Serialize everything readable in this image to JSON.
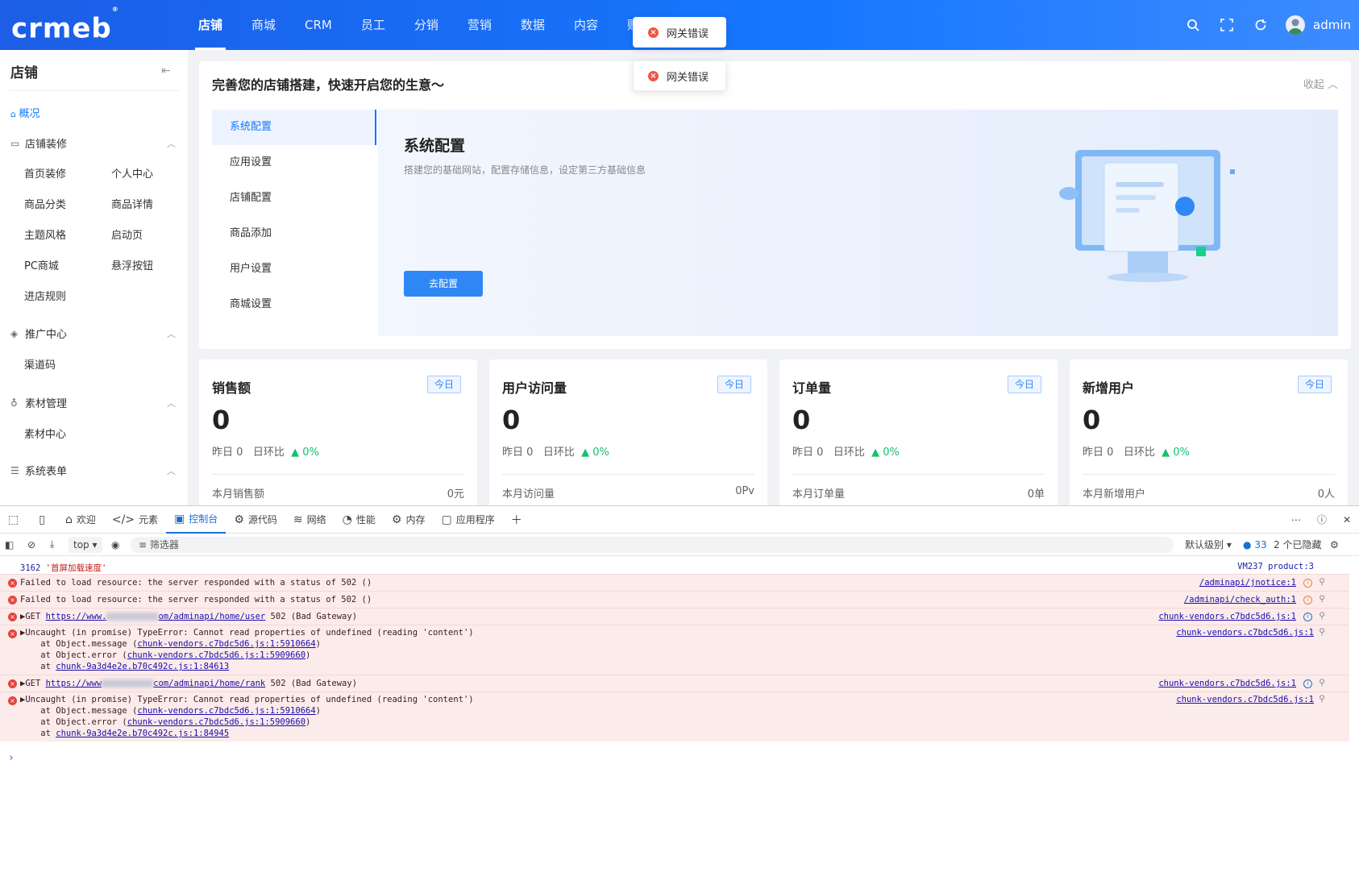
{
  "header": {
    "logo": "crmeb",
    "nav": [
      "店铺",
      "商城",
      "CRM",
      "员工",
      "分销",
      "营销",
      "数据",
      "内容",
      "财务"
    ],
    "username": "admin"
  },
  "sidebar": {
    "title": "店铺",
    "overview": "概况",
    "groups": [
      {
        "label": "店铺装修",
        "items": [
          "首页装修",
          "个人中心",
          "商品分类",
          "商品详情",
          "主题风格",
          "启动页",
          "PC商城",
          "悬浮按钮",
          "进店规则"
        ]
      },
      {
        "label": "推广中心",
        "items": [
          "渠道码"
        ]
      },
      {
        "label": "素材管理",
        "items": [
          "素材中心"
        ]
      },
      {
        "label": "系统表单",
        "items": []
      }
    ]
  },
  "guide": {
    "title": "完善您的店铺搭建，快速开启您的生意～",
    "collapse": "收起",
    "tabs": [
      "系统配置",
      "应用设置",
      "店铺配置",
      "商品添加",
      "用户设置",
      "商城设置"
    ],
    "panel_title": "系统配置",
    "panel_desc": "搭建您的基础网站，配置存储信息，设定第三方基础信息",
    "panel_button": "去配置"
  },
  "stats": [
    {
      "title": "销售额",
      "tag": "今日",
      "value": "0",
      "yesterday": "昨日 0",
      "ratio_label": "日环比",
      "ratio": "0%",
      "foot_label": "本月销售额",
      "foot_value": "0元"
    },
    {
      "title": "用户访问量",
      "tag": "今日",
      "value": "0",
      "yesterday": "昨日 0",
      "ratio_label": "日环比",
      "ratio": "0%",
      "foot_label": "本月访问量",
      "foot_value": "0Pv"
    },
    {
      "title": "订单量",
      "tag": "今日",
      "value": "0",
      "yesterday": "昨日 0",
      "ratio_label": "日环比",
      "ratio": "0%",
      "foot_label": "本月订单量",
      "foot_value": "0单"
    },
    {
      "title": "新增用户",
      "tag": "今日",
      "value": "0",
      "yesterday": "昨日 0",
      "ratio_label": "日环比",
      "ratio": "0%",
      "foot_label": "本月新增用户",
      "foot_value": "0人"
    }
  ],
  "toasts": [
    "网关错误",
    "网关错误"
  ],
  "devtools": {
    "tabs": [
      "欢迎",
      "元素",
      "控制台",
      "源代码",
      "网络",
      "性能",
      "内存",
      "应用程序"
    ],
    "context": "top",
    "filter_placeholder": "筛选器",
    "level": "默认级别",
    "msg_count": "33",
    "hidden": "2 个已隐藏",
    "logs": {
      "l1_num": "3162",
      "l1_text": "'首屏加载速度'",
      "l1_src": "VM237 product:3",
      "l2_text": "Failed to load resource: the server responded with a status of 502 ()",
      "l2_src": "/adminapi/jnotice:1",
      "l3_text": "Failed to load resource: the server responded with a status of 502 ()",
      "l3_src": "/adminapi/check_auth:1",
      "l4_pre": "▶GET ",
      "l4_url_a": "https://www.",
      "l4_url_b": "om/adminapi/home/user",
      "l4_post": " 502 (Bad Gateway)",
      "l4_src": "chunk-vendors.c7bdc5d6.js:1",
      "l5_text": "▶Uncaught (in promise) TypeError: Cannot read properties of undefined (reading 'content')",
      "l5_src": "chunk-vendors.c7bdc5d6.js:1",
      "l5_a_pre": "    at Object.message (",
      "l5_a_link": "chunk-vendors.c7bdc5d6.js:1:5910664",
      "l5_b_pre": "    at Object.error (",
      "l5_b_link": "chunk-vendors.c7bdc5d6.js:1:5909660",
      "l5_c_pre": "    at ",
      "l5_c_link": "chunk-9a3d4e2e.b70c492c.js:1:84613",
      "l6_pre": "▶GET ",
      "l6_url_a": "https://www",
      "l6_url_b": "com/adminapi/home/rank",
      "l6_post": " 502 (Bad Gateway)",
      "l6_src": "chunk-vendors.c7bdc5d6.js:1",
      "l7_text": "▶Uncaught (in promise) TypeError: Cannot read properties of undefined (reading 'content')",
      "l7_src": "chunk-vendors.c7bdc5d6.js:1",
      "l7_a_link": "chunk-vendors.c7bdc5d6.js:1:5910664",
      "l7_b_link": "chunk-vendors.c7bdc5d6.js:1:5909660",
      "l7_c_link": "chunk-9a3d4e2e.b70c492c.js:1:84945",
      "close_paren": ")"
    }
  },
  "colors": {
    "primary": "#1677ff",
    "success": "#13c26b",
    "error": "#f05443"
  }
}
